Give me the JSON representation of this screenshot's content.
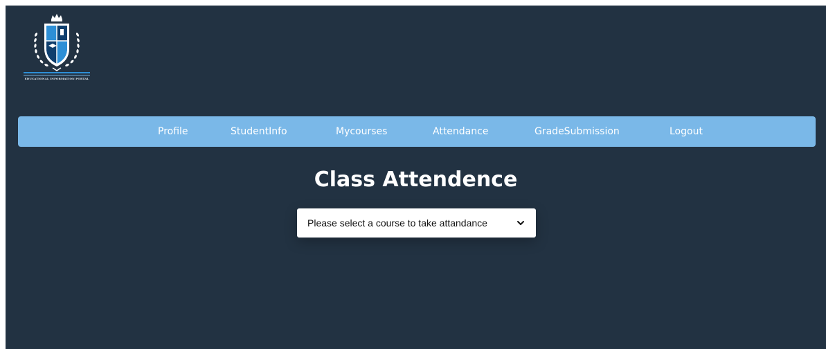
{
  "logo": {
    "caption": "EDUCATIONAL INFORMATION PORTAL",
    "shield_letters": [
      "E",
      "I",
      "P"
    ]
  },
  "nav": {
    "items": [
      {
        "label": "Profile"
      },
      {
        "label": "StudentInfo"
      },
      {
        "label": "Mycourses"
      },
      {
        "label": "Attendance"
      },
      {
        "label": "GradeSubmission"
      },
      {
        "label": "Logout"
      }
    ]
  },
  "main": {
    "title": "Class Attendence",
    "course_select": {
      "selected": "Please select a course to take attandance",
      "icon": "chevron-down-icon"
    }
  },
  "colors": {
    "background": "#223242",
    "navbar": "#7ab8e8",
    "nav_text": "#ffffff",
    "title": "#ffffff",
    "select_bg": "#ffffff"
  }
}
